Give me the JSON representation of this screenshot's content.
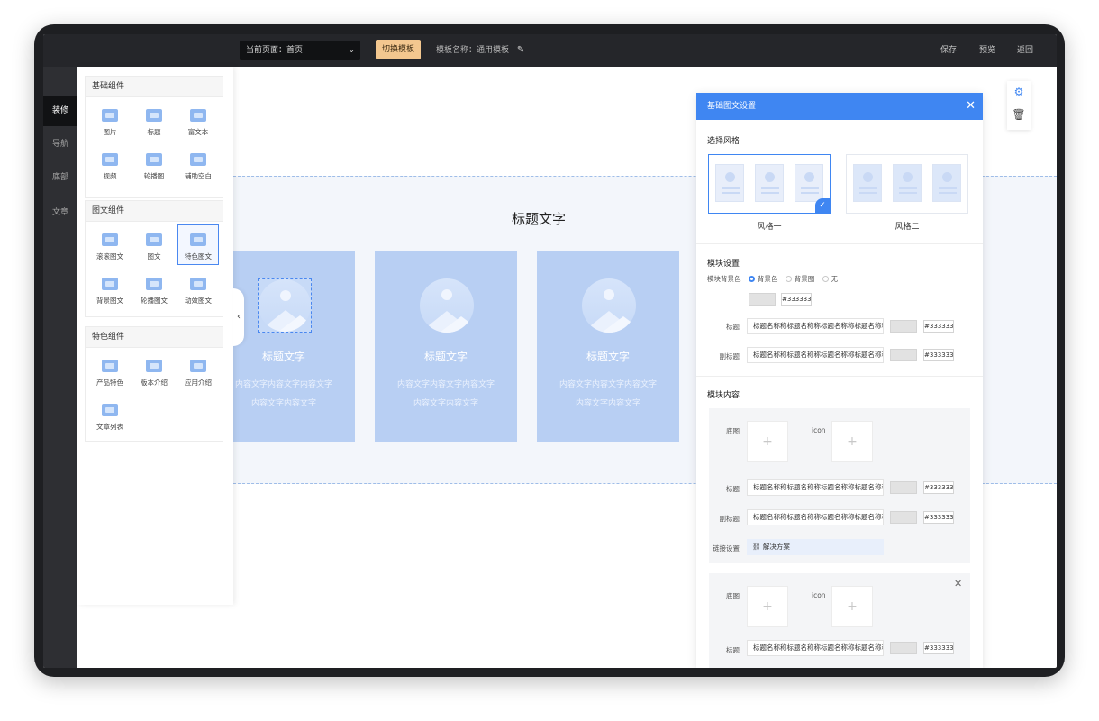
{
  "topbar": {
    "page_select": "当前页面：首页",
    "switch_template": "切换模板",
    "template_name": "模板名称：通用模板",
    "save": "保存",
    "preview": "预览",
    "back": "返回"
  },
  "nav": [
    {
      "label": "装修",
      "active": true
    },
    {
      "label": "导航",
      "active": false
    },
    {
      "label": "底部",
      "active": false
    },
    {
      "label": "文章",
      "active": false
    }
  ],
  "groups": [
    {
      "title": "基础组件",
      "items": [
        "图片",
        "标题",
        "富文本",
        "视频",
        "轮播图",
        "辅助空白"
      ]
    },
    {
      "title": "图文组件",
      "items": [
        "滚滚图文",
        "图文",
        "特色图文",
        "背景图文",
        "轮播图文",
        "动效图文"
      ],
      "selected": 2
    },
    {
      "title": "特色组件",
      "items": [
        "产品特色",
        "版本介绍",
        "应用介绍",
        "文章列表"
      ]
    }
  ],
  "canvas": {
    "section_title": "标题文字",
    "cards": [
      {
        "title": "标题文字",
        "line1": "内容文字内容文字内容文字",
        "line2": "内容文字内容文字",
        "selected": true
      },
      {
        "title": "标题文字",
        "line1": "内容文字内容文字内容文字",
        "line2": "内容文字内容文字",
        "selected": false
      },
      {
        "title": "标题文字",
        "line1": "内容文字内容文字内容文字",
        "line2": "内容文字内容文字",
        "selected": false
      }
    ]
  },
  "settings": {
    "title": "基础图文设置",
    "choose_style": "选择风格",
    "style_one": "风格一",
    "style_two": "风格二",
    "module_settings": "模块设置",
    "bg_label": "模块背景色",
    "radio_bg_color": "背景色",
    "radio_bg_image": "背景图",
    "radio_none": "无",
    "bg_hex": "#333333",
    "title_label": "标题",
    "title_value": "标题名称称标题名称称标题名称称标题名称称",
    "title_hex": "#333333",
    "subtitle_label": "副标题",
    "subtitle_value": "标题名称称标题名称称标题名称称标题名称称",
    "subtitle_hex": "#333333",
    "module_content": "模块内容",
    "bottom_image": "底图",
    "icon_label": "icon",
    "plus": "+",
    "item_title_label": "标题",
    "item_title_value": "标题名称称标题名称称标题名称称标题名称称",
    "item_title_hex": "#333333",
    "item_subtitle_label": "副标题",
    "item_subtitle_value": "标题名称称标题名称称标题名称称标题名称称",
    "item_subtitle_hex": "#333333",
    "link_label": "链接设置",
    "link_value": "解决方案"
  },
  "colors": {
    "accent": "#3f86f2",
    "switch_button": "#f3c78f",
    "card": "#b8cff3"
  }
}
